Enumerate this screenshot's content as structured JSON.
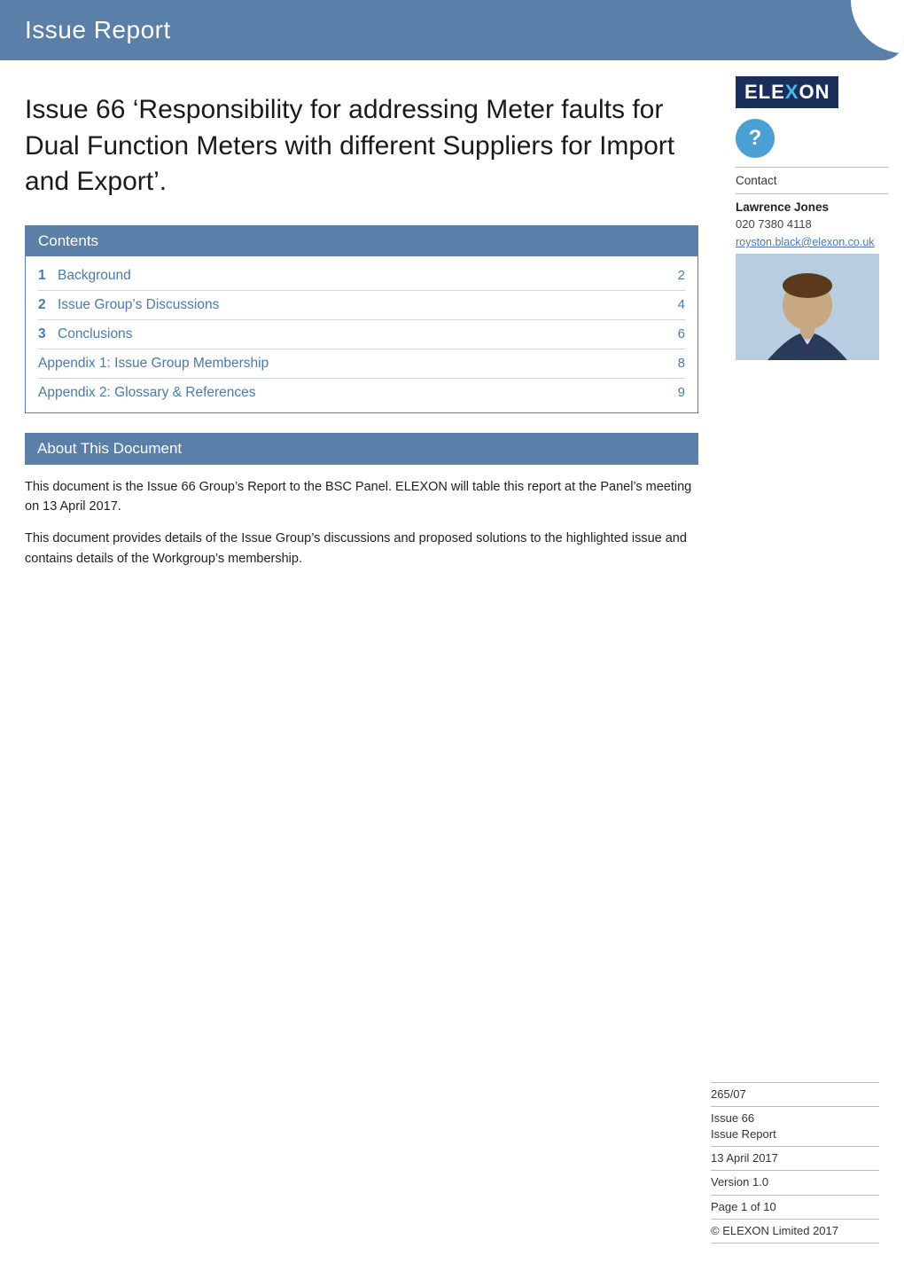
{
  "header": {
    "title": "Issue Report"
  },
  "doc_title": "Issue 66 ‘Responsibility for addressing Meter faults for Dual Function Meters with different Suppliers for Import and Export’.",
  "contents": {
    "label": "Contents",
    "items": [
      {
        "num": "1",
        "label": "Background",
        "page": "2"
      },
      {
        "num": "2",
        "label": "Issue Group’s Discussions",
        "page": "4"
      },
      {
        "num": "3",
        "label": "Conclusions",
        "page": "6"
      }
    ],
    "appendix_items": [
      {
        "label": "Appendix 1: Issue Group Membership",
        "page": "8"
      },
      {
        "label": "Appendix 2: Glossary & References",
        "page": "9"
      }
    ]
  },
  "about": {
    "label": "About This Document",
    "paragraphs": [
      "This document is the Issue 66 Group’s Report to the BSC Panel. ELEXON will table this report at the Panel’s meeting on 13 April 2017.",
      "This document provides details of the Issue Group’s discussions and proposed solutions to the highlighted issue and contains details of the Workgroup’s membership."
    ]
  },
  "sidebar": {
    "logo_text_left": "ELE",
    "logo_text_x": "X",
    "logo_text_right": "ON",
    "contact_label": "Contact",
    "contact_name": "Lawrence Jones",
    "contact_phone": "020 7380 4118",
    "contact_email": "royston.black@elexon.co.uk",
    "question_icon": "?"
  },
  "metadata": {
    "doc_number": "265/07",
    "issue_line1": "Issue 66",
    "issue_line2": "Issue Report",
    "date": "13 April 2017",
    "version": "Version 1.0",
    "page": "Page 1 of 10",
    "copyright": "© ELEXON Limited 2017"
  }
}
